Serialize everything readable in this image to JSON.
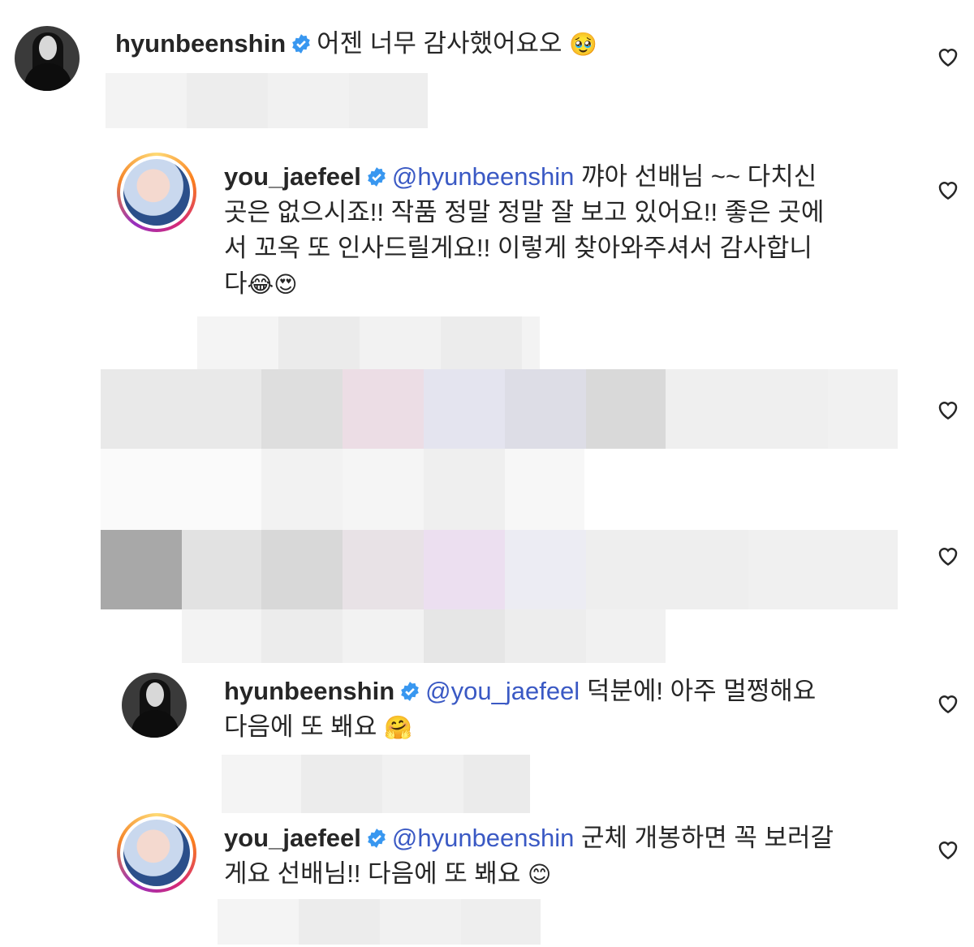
{
  "comments": [
    {
      "username": "hyunbeenshin",
      "text": "어젠 너무 감사했어요오",
      "emoji": "🥹"
    },
    {
      "username": "you_jaefeel",
      "mention": "@hyunbeenshin",
      "line1": "꺄아 선배님 ~~ 다치신",
      "line2": "곳은 없으시죠!! 작품 정말 정말 잘 보고 있어요!! 좋은 곳에",
      "line3": "서 꼬옥 또 인사드릴게요!! 이렇게 찾아와주셔서 감사합니",
      "line4": "다",
      "emoji": "😂😍"
    },
    {
      "username": "hyunbeenshin",
      "mention": "@you_jaefeel",
      "line1": "덕분에! 아주 멀쩡해요",
      "line2": "다음에 또 봬요",
      "emoji": "🤗"
    },
    {
      "username": "you_jaefeel",
      "mention": "@hyunbeenshin",
      "line1": "군체 개봉하면 꼭 보러갈",
      "line2": "게요 선배님!! 다음에 또 봬요",
      "emoji": "😊"
    }
  ],
  "icons": {
    "verified": "verified-badge-icon",
    "like": "heart-icon"
  },
  "colors": {
    "mention": "#3a59c4",
    "verified": "#3897f0"
  }
}
